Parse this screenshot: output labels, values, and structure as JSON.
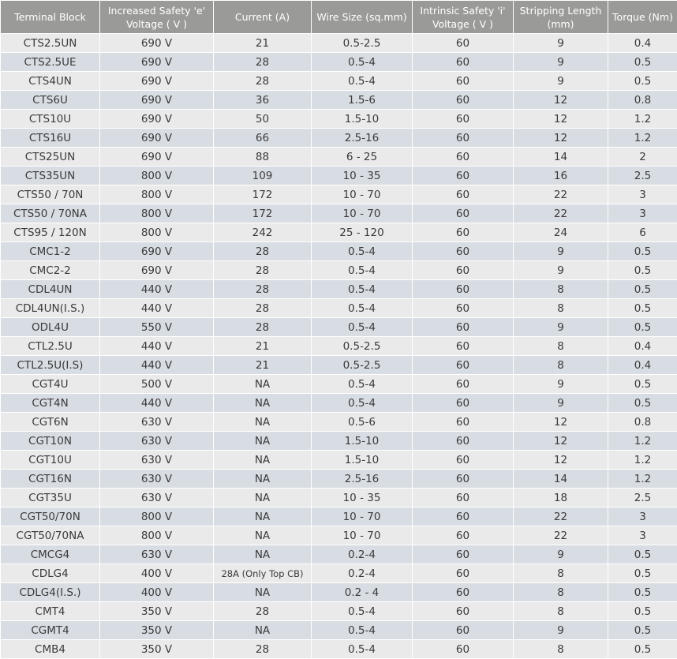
{
  "table": {
    "headers": [
      "Terminal Block",
      "Increased Safety 'e' Voltage ( V )",
      "Current (A)",
      "Wire Size (sq.mm)",
      "Intrinsic Safety 'i' Voltage ( V )",
      "Stripping Length (mm)",
      "Torque (Nm)"
    ],
    "rows": [
      [
        "CTS2.5UN",
        "690 V",
        "21",
        "0.5-2.5",
        "60",
        "9",
        "0.4"
      ],
      [
        "CTS2.5UE",
        "690 V",
        "28",
        "0.5-4",
        "60",
        "9",
        "0.5"
      ],
      [
        "CTS4UN",
        "690 V",
        "28",
        "0.5-4",
        "60",
        "9",
        "0.5"
      ],
      [
        "CTS6U",
        "690 V",
        "36",
        "1.5-6",
        "60",
        "12",
        "0.8"
      ],
      [
        "CTS10U",
        "690 V",
        "50",
        "1.5-10",
        "60",
        "12",
        "1.2"
      ],
      [
        "CTS16U",
        "690 V",
        "66",
        "2.5-16",
        "60",
        "12",
        "1.2"
      ],
      [
        "CTS25UN",
        "690 V",
        "88",
        "6 - 25",
        "60",
        "14",
        "2"
      ],
      [
        "CTS35UN",
        "800 V",
        "109",
        "10 - 35",
        "60",
        "16",
        "2.5"
      ],
      [
        "CTS50 / 70N",
        "800 V",
        "172",
        "10 - 70",
        "60",
        "22",
        "3"
      ],
      [
        "CTS50 / 70NA",
        "800 V",
        "172",
        "10 - 70",
        "60",
        "22",
        "3"
      ],
      [
        "CTS95 / 120N",
        "800 V",
        "242",
        "25 - 120",
        "60",
        "24",
        "6"
      ],
      [
        "CMC1-2",
        "690 V",
        "28",
        "0.5-4",
        "60",
        "9",
        "0.5"
      ],
      [
        "CMC2-2",
        "690 V",
        "28",
        "0.5-4",
        "60",
        "9",
        "0.5"
      ],
      [
        "CDL4UN",
        "440 V",
        "28",
        "0.5-4",
        "60",
        "8",
        "0.5"
      ],
      [
        "CDL4UN(I.S.)",
        "440 V",
        "28",
        "0.5-4",
        "60",
        "8",
        "0.5"
      ],
      [
        "ODL4U",
        "550 V",
        "28",
        "0.5-4",
        "60",
        "9",
        "0.5"
      ],
      [
        "CTL2.5U",
        "440 V",
        "21",
        "0.5-2.5",
        "60",
        "8",
        "0.4"
      ],
      [
        "CTL2.5U(I.S)",
        "440 V",
        "21",
        "0.5-2.5",
        "60",
        "8",
        "0.4"
      ],
      [
        "CGT4U",
        "500 V",
        "NA",
        "0.5-4",
        "60",
        "9",
        "0.5"
      ],
      [
        "CGT4N",
        "440 V",
        "NA",
        "0.5-4",
        "60",
        "9",
        "0.5"
      ],
      [
        "CGT6N",
        "630 V",
        "NA",
        "0.5-6",
        "60",
        "12",
        "0.8"
      ],
      [
        "CGT10N",
        "630 V",
        "NA",
        "1.5-10",
        "60",
        "12",
        "1.2"
      ],
      [
        "CGT10U",
        "630 V",
        "NA",
        "1.5-10",
        "60",
        "12",
        "1.2"
      ],
      [
        "CGT16N",
        "630 V",
        "NA",
        "2.5-16",
        "60",
        "14",
        "1.2"
      ],
      [
        "CGT35U",
        "630 V",
        "NA",
        "10 - 35",
        "60",
        "18",
        "2.5"
      ],
      [
        "CGT50/70N",
        "800 V",
        "NA",
        "10 - 70",
        "60",
        "22",
        "3"
      ],
      [
        "CGT50/70NA",
        "800 V",
        "NA",
        "10 - 70",
        "60",
        "22",
        "3"
      ],
      [
        "CMCG4",
        "630 V",
        "NA",
        "0.2-4",
        "60",
        "9",
        "0.5"
      ],
      [
        "CDLG4",
        "400 V",
        "28A (Only Top CB)",
        "0.2-4",
        "60",
        "8",
        "0.5"
      ],
      [
        "CDLG4(I.S.)",
        "400 V",
        "NA",
        "0.2 - 4",
        "60",
        "8",
        "0.5"
      ],
      [
        "CMT4",
        "350 V",
        "28",
        "0.5-4",
        "60",
        "8",
        "0.5"
      ],
      [
        "CGMT4",
        "350 V",
        "NA",
        "0.5-4",
        "60",
        "9",
        "0.5"
      ],
      [
        "CMB4",
        "350 V",
        "28",
        "0.5-4",
        "60",
        "8",
        "0.5"
      ]
    ]
  }
}
